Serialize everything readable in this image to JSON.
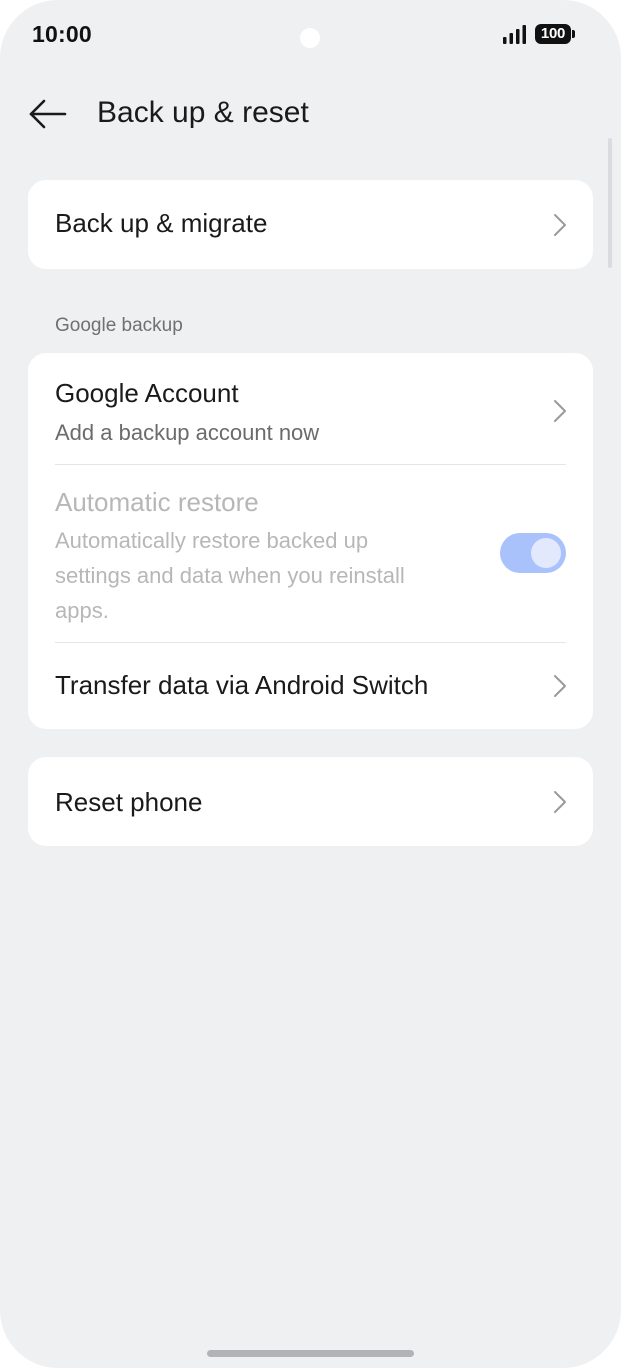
{
  "status_bar": {
    "time": "10:00",
    "battery_level": "100",
    "signal_icon": "signal-bars-icon",
    "battery_icon": "battery-icon"
  },
  "header": {
    "back_icon": "arrow-left-icon",
    "title": "Back up & reset"
  },
  "items": {
    "backup_migrate": {
      "title": "Back up & migrate"
    },
    "google_section_label": "Google backup",
    "google_account": {
      "title": "Google Account",
      "subtitle": "Add a backup account now"
    },
    "automatic_restore": {
      "title": "Automatic restore",
      "subtitle_line1": "Automatically restore backed up",
      "subtitle_line2": "settings and data when you reinstall",
      "subtitle_line3": "apps.",
      "enabled": false,
      "toggle_on": true
    },
    "transfer_data": {
      "title": "Transfer data via Android Switch"
    },
    "reset_phone": {
      "title": "Reset phone"
    }
  },
  "colors": {
    "background": "#eff0f2",
    "card": "#ffffff",
    "toggle_track": "#a9c2fb",
    "toggle_knob": "#e2e9fd",
    "disabled_text": "#b7b7b9"
  }
}
